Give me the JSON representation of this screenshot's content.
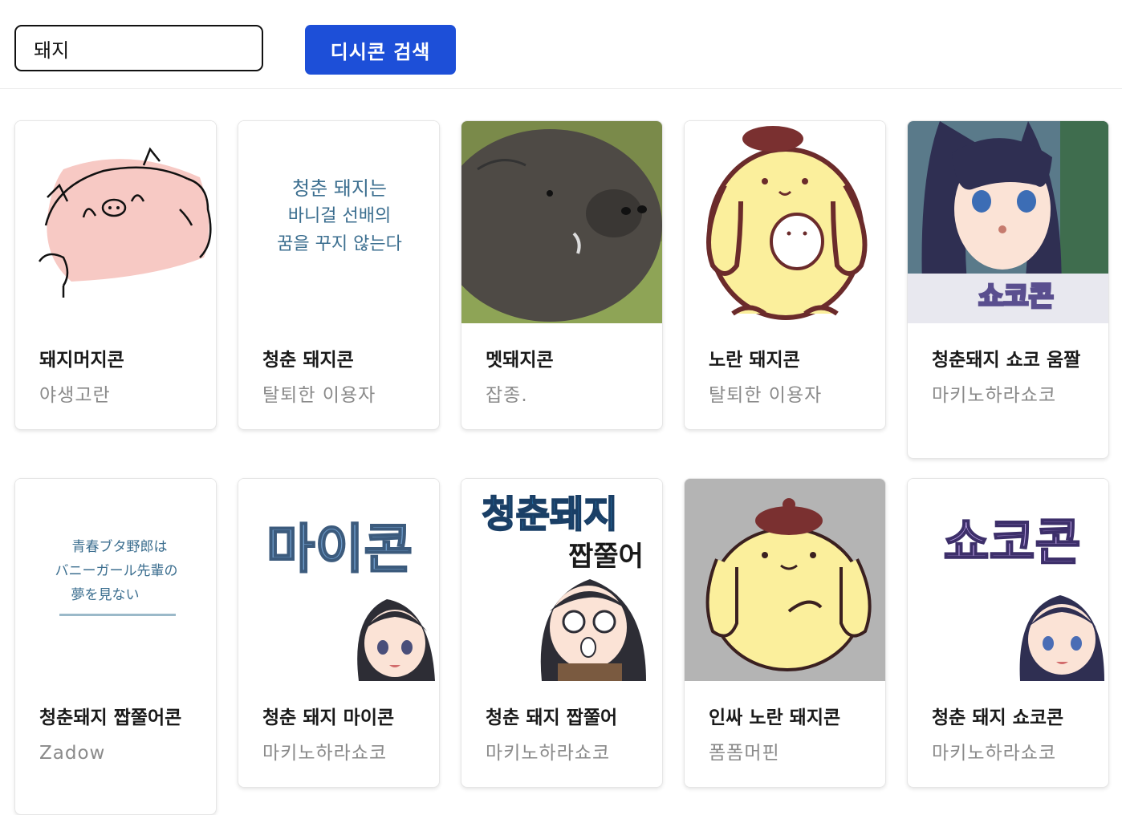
{
  "search": {
    "value": "돼지",
    "button_label": "디시콘 검색"
  },
  "cards": [
    {
      "title": "돼지머지콘",
      "author": "야생고란"
    },
    {
      "title": "청춘 돼지콘",
      "author": "탈퇴한 이용자",
      "image_text": [
        "청춘 돼지는",
        "바니걸 선배의",
        "꿈을 꾸지 않는다"
      ]
    },
    {
      "title": "멧돼지콘",
      "author": "잡종."
    },
    {
      "title": "노란 돼지콘",
      "author": "탈퇴한 이용자"
    },
    {
      "title": "청춘돼지 쇼코 움짤",
      "author": "마키노하라쇼코",
      "image_text": [
        "쇼코콘"
      ]
    },
    {
      "title": "청춘돼지 짭쭐어콘",
      "author": "Zadow",
      "image_text": [
        "青春ブタ野郎は",
        "バニーガール先輩の",
        "夢を見ない"
      ]
    },
    {
      "title": "청춘 돼지 마이콘",
      "author": "마키노하라쇼코",
      "image_text": [
        "마이콘"
      ]
    },
    {
      "title": "청춘 돼지 짭쭐어",
      "author": "마키노하라쇼코",
      "image_text": [
        "청춘돼지",
        "짭쭐어"
      ]
    },
    {
      "title": "인싸 노란 돼지콘",
      "author": "폼폼머핀"
    },
    {
      "title": "청춘 돼지 쇼코콘",
      "author": "마키노하라쇼코",
      "image_text": [
        "쇼코콘"
      ]
    }
  ],
  "colors": {
    "accent": "#1d4fd8",
    "muted_text": "#8a8a8a"
  }
}
